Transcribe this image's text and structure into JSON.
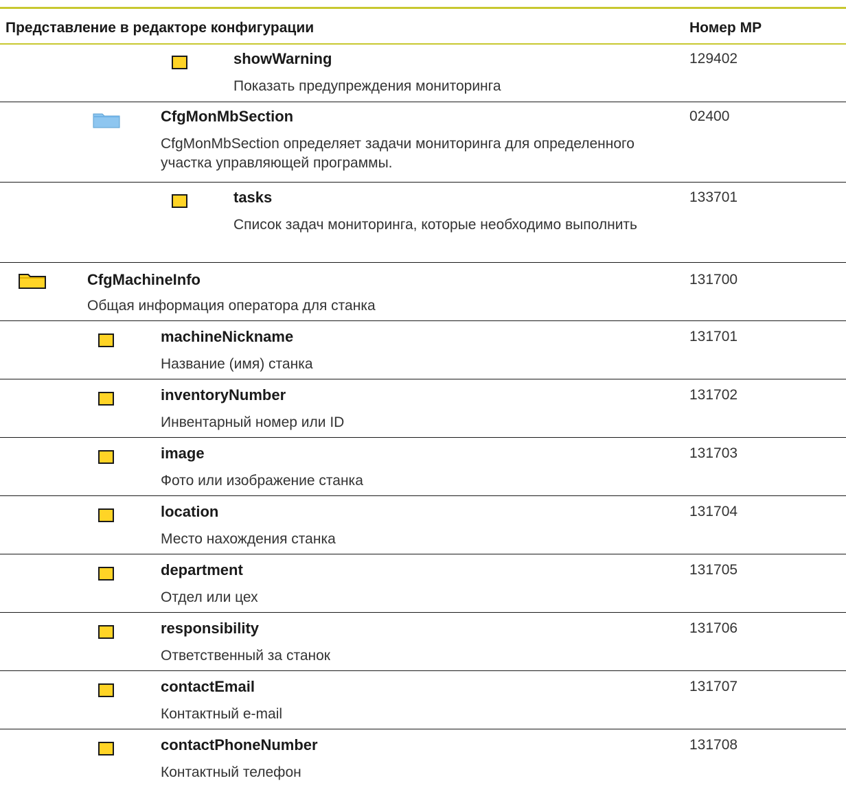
{
  "header": {
    "col_view": "Представление в редакторе конфигурации",
    "col_mp": "Номер MP"
  },
  "rows": [
    {
      "icon": "parameter-icon",
      "name": "showWarning",
      "description": "Показать предупреждения мониторинга",
      "mp": "129402"
    },
    {
      "icon": "folder-icon",
      "icon_color": "#8ec6f0",
      "name": "CfgMonMbSection",
      "description": "CfgMonMbSection определяет задачи мониторинга для определенного участка управляющей программы.",
      "mp": "02400"
    },
    {
      "icon": "parameter-icon",
      "name": "tasks",
      "description": "Список задач мониторинга, которые необходимо выполнить",
      "mp": "133701"
    },
    {
      "icon": "folder-icon",
      "icon_color": "#ffd426",
      "name": "CfgMachineInfo",
      "description": "Общая информация оператора для станка",
      "mp": "131700"
    },
    {
      "icon": "parameter-icon",
      "name": "machineNickname",
      "description": "Название (имя) станка",
      "mp": "131701"
    },
    {
      "icon": "parameter-icon",
      "name": "inventoryNumber",
      "description": "Инвентарный номер или ID",
      "mp": "131702"
    },
    {
      "icon": "parameter-icon",
      "name": "image",
      "description": "Фото или изображение станка",
      "mp": "131703"
    },
    {
      "icon": "parameter-icon",
      "name": "location",
      "description": "Место нахождения станка",
      "mp": "131704"
    },
    {
      "icon": "parameter-icon",
      "name": "department",
      "description": "Отдел или цех",
      "mp": "131705"
    },
    {
      "icon": "parameter-icon",
      "name": "responsibility",
      "description": "Ответственный за станок",
      "mp": "131706"
    },
    {
      "icon": "parameter-icon",
      "name": "contactEmail",
      "description": "Контактный e-mail",
      "mp": "131707"
    },
    {
      "icon": "parameter-icon",
      "name": "contactPhoneNumber",
      "description": "Контактный телефон",
      "mp": "131708"
    }
  ],
  "colors": {
    "parameter_fill": "#ffd426",
    "rule_accent": "#c8c830"
  }
}
